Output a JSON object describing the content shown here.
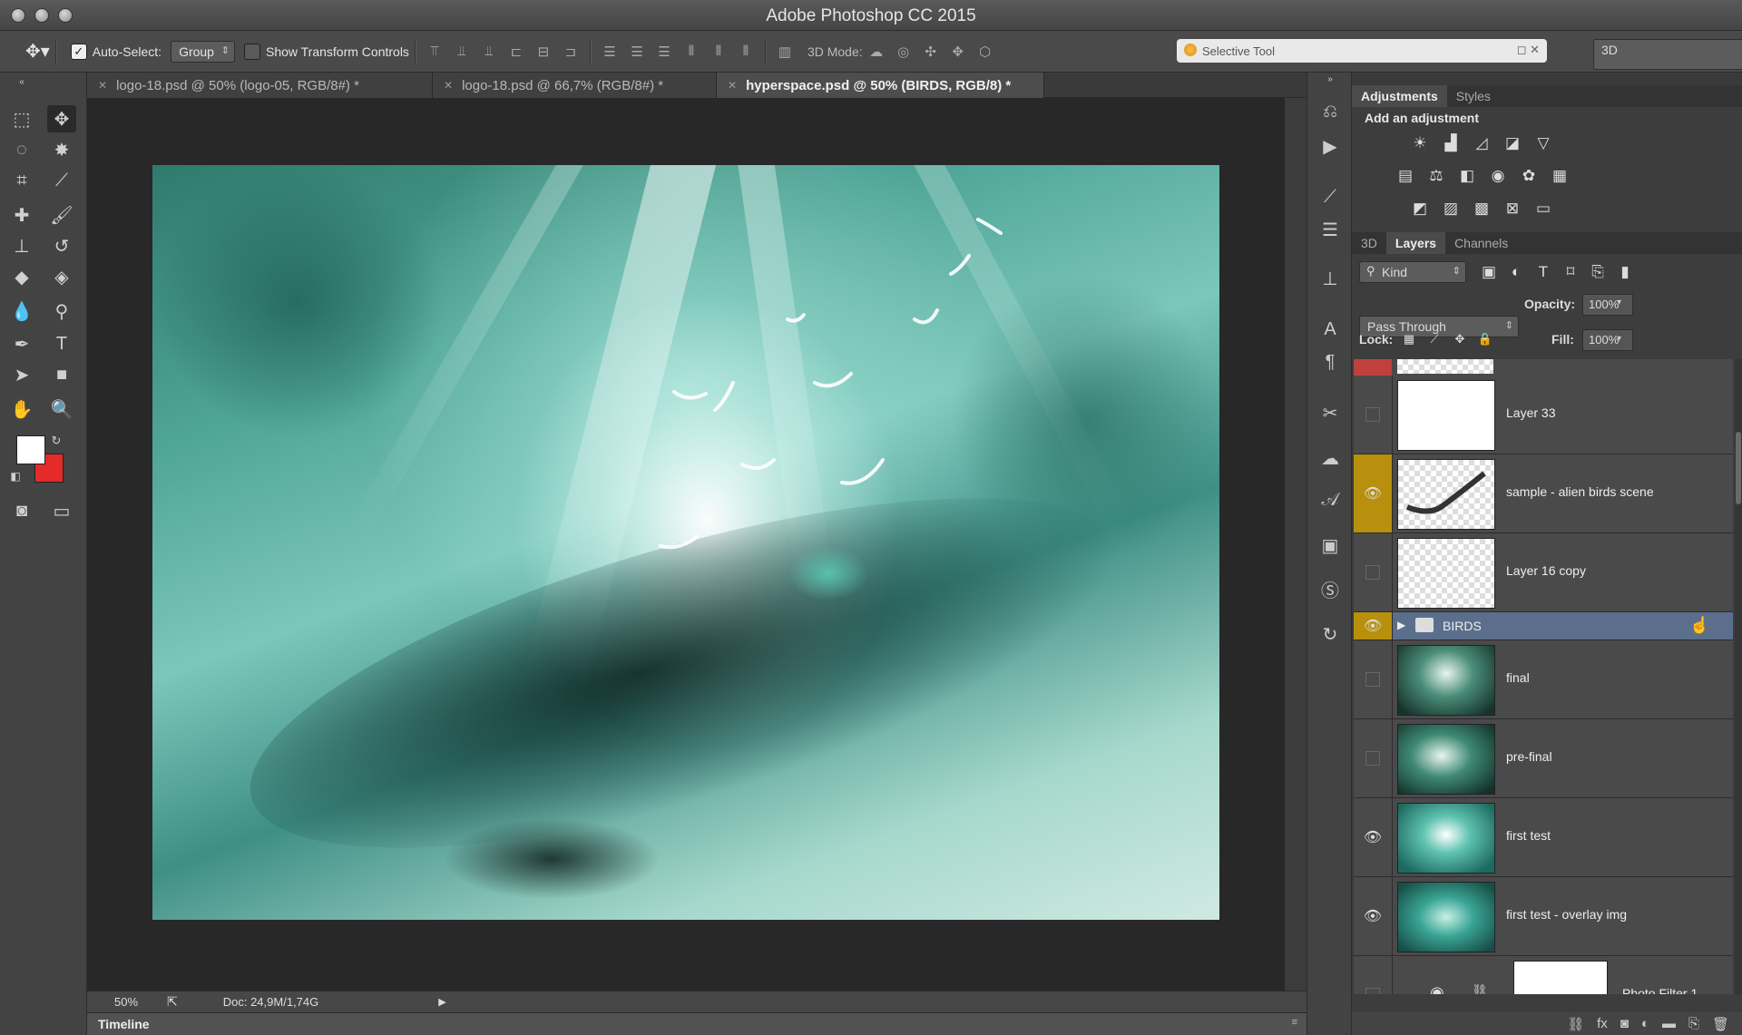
{
  "app": {
    "title": "Adobe Photoshop CC 2015"
  },
  "options_bar": {
    "auto_select_label": "Auto-Select:",
    "auto_select_value": "Group",
    "show_transform_label": "Show Transform Controls",
    "mode_3d_label": "3D Mode:",
    "search_value": "Selective Tool",
    "workspace_value": "3D"
  },
  "tabs": [
    {
      "label": "logo-18.psd @ 50% (logo-05, RGB/8#) *"
    },
    {
      "label": "logo-18.psd @ 66,7% (RGB/8#) *"
    },
    {
      "label": "hyperspace.psd @ 50% (BIRDS, RGB/8) *"
    }
  ],
  "status": {
    "zoom": "50%",
    "doc": "Doc: 24,9M/1,74G"
  },
  "timeline": {
    "label": "Timeline"
  },
  "adjustments": {
    "tabs": [
      "Adjustments",
      "Styles"
    ],
    "heading": "Add an adjustment"
  },
  "layers_panel": {
    "tabs": [
      "3D",
      "Layers",
      "Channels"
    ],
    "filter_kind": "Kind",
    "blend_mode": "Pass Through",
    "opacity_label": "Opacity:",
    "opacity_value": "100%",
    "lock_label": "Lock:",
    "fill_label": "Fill:",
    "fill_value": "100%",
    "layers": [
      {
        "name": "Layer 33",
        "visible": false
      },
      {
        "name": "sample - alien birds scene",
        "visible": true
      },
      {
        "name": "Layer 16 copy",
        "visible": false
      },
      {
        "name": "BIRDS",
        "visible": true,
        "type": "group"
      },
      {
        "name": "final",
        "visible": false
      },
      {
        "name": "pre-final",
        "visible": false
      },
      {
        "name": "first test",
        "visible": true
      },
      {
        "name": "first test - overlay img",
        "visible": true
      },
      {
        "name": "Photo Filter 1",
        "visible": false
      }
    ]
  },
  "colors": {
    "accent_eye": "#b8900e",
    "selected_group": "#5b6f8c",
    "foreground": "#ffffff",
    "background": "#e52a2a"
  }
}
